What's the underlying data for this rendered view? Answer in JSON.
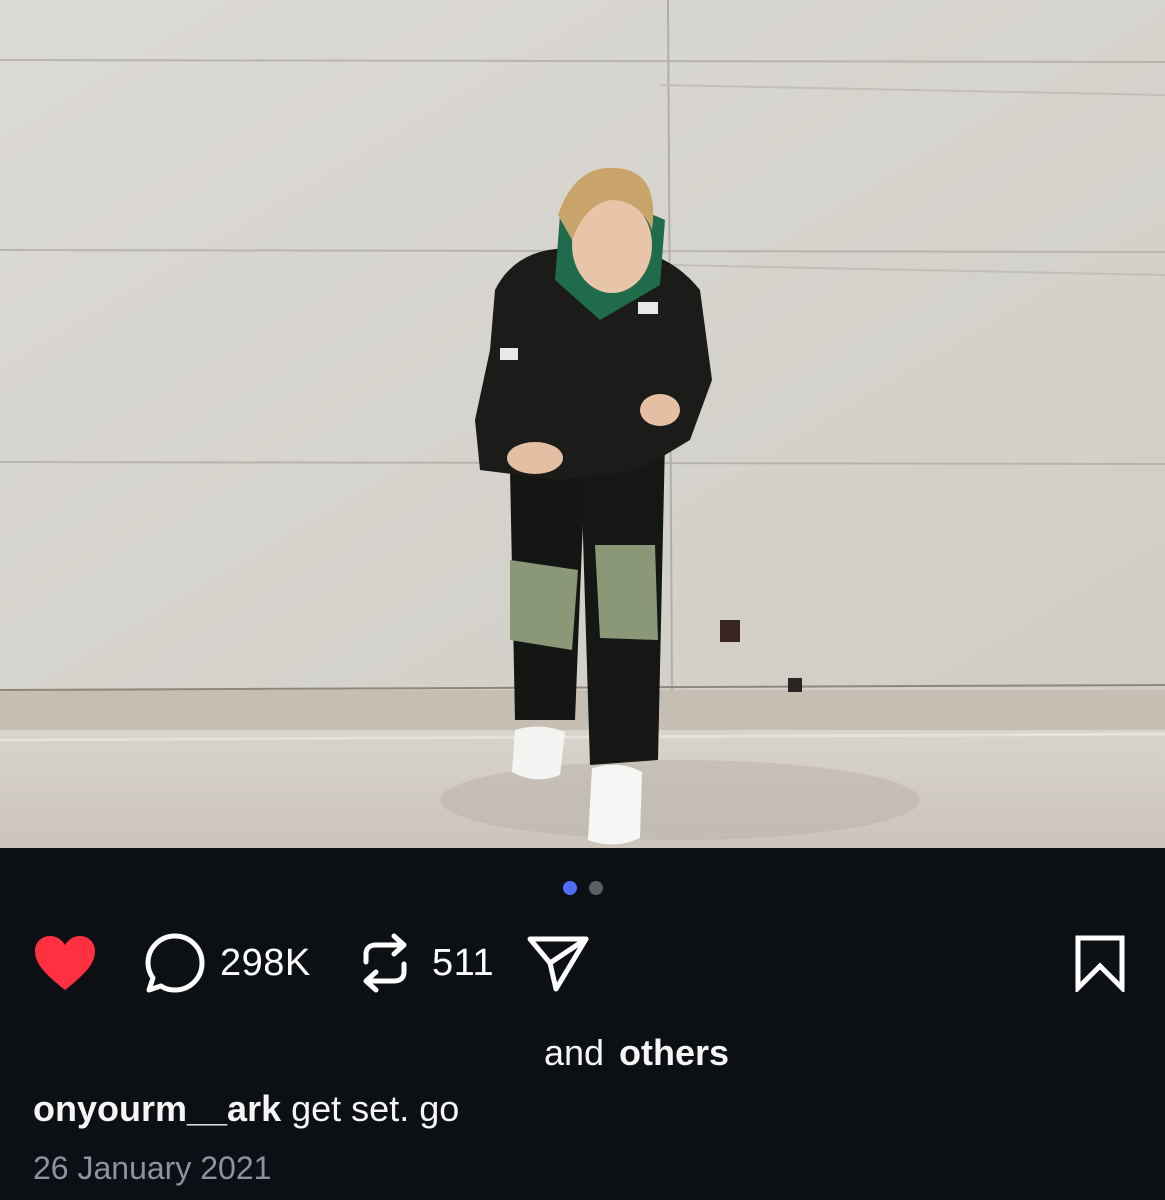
{
  "post": {
    "media_count": 2,
    "active_media_index": 1
  },
  "actions": {
    "like_icon": "heart-filled-icon",
    "like_color": "#ff3040",
    "comment_icon": "comment-bubble-icon",
    "comment_count": "298K",
    "repost_icon": "repost-arrows-icon",
    "repost_count": "511",
    "share_icon": "paper-plane-icon",
    "save_icon": "bookmark-icon"
  },
  "likes": {
    "and_text": "and",
    "others_text": "others"
  },
  "caption": {
    "username": "onyourm__ark",
    "text": "get set. go"
  },
  "date": "26 January 2021",
  "colors": {
    "background": "#0c1014",
    "accent_dot": "#4f6ef7",
    "like_red": "#ff3040",
    "muted_text": "#8e9399"
  }
}
